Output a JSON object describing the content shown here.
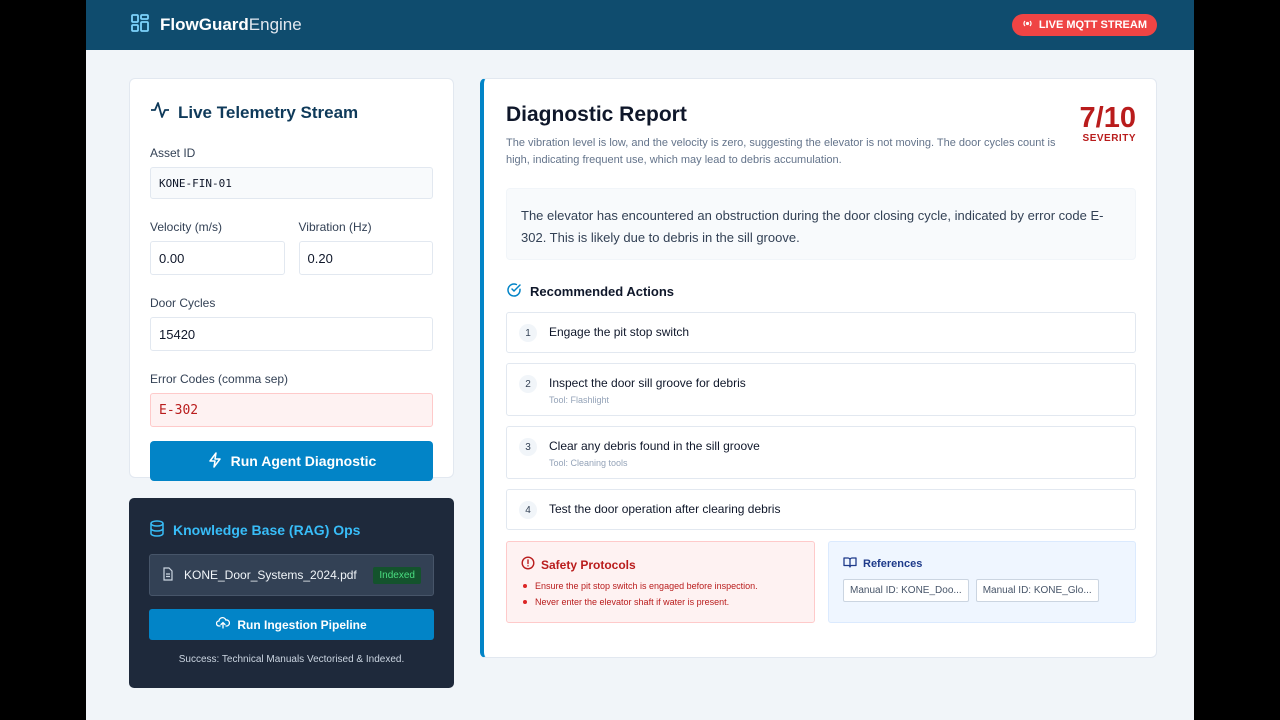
{
  "header": {
    "brand_bold": "FlowGuard",
    "brand_light": "Engine",
    "live_badge": "LIVE MQTT STREAM"
  },
  "telemetry": {
    "title": "Live Telemetry Stream",
    "asset_label": "Asset ID",
    "asset_value": "KONE-FIN-01",
    "velocity_label": "Velocity (m/s)",
    "velocity_value": "0.00",
    "vibration_label": "Vibration (Hz)",
    "vibration_value": "0.20",
    "door_label": "Door Cycles",
    "door_value": "15420",
    "error_label": "Error Codes (comma sep)",
    "error_value": "E-302",
    "run_label": "Run Agent Diagnostic"
  },
  "kb": {
    "title": "Knowledge Base (RAG) Ops",
    "file_name": "KONE_Door_Systems_2024.pdf",
    "file_status": "Indexed",
    "ingest_label": "Run Ingestion Pipeline",
    "status": "Success: Technical Manuals Vectorised & Indexed."
  },
  "report": {
    "title": "Diagnostic Report",
    "subtitle": "The vibration level is low, and the velocity is zero, suggesting the elevator is not moving. The door cycles count is high, indicating frequent use, which may lead to debris accumulation.",
    "severity_value": "7/10",
    "severity_label": "SEVERITY",
    "summary": "The elevator has encountered an obstruction during the door closing cycle, indicated by error code E-302. This is likely due to debris in the sill groove.",
    "actions_title": "Recommended Actions",
    "steps": [
      {
        "num": "1",
        "text": "Engage the pit stop switch",
        "tool": ""
      },
      {
        "num": "2",
        "text": "Inspect the door sill groove for debris",
        "tool": "Tool: Flashlight"
      },
      {
        "num": "3",
        "text": "Clear any debris found in the sill groove",
        "tool": "Tool: Cleaning tools"
      },
      {
        "num": "4",
        "text": "Test the door operation after clearing debris",
        "tool": ""
      }
    ],
    "safety_title": "Safety Protocols",
    "safety_items": [
      "Ensure the pit stop switch is engaged before inspection.",
      "Never enter the elevator shaft if water is present."
    ],
    "refs_title": "References",
    "refs": [
      "Manual ID: KONE_Doo...",
      "Manual ID: KONE_Glo..."
    ]
  }
}
